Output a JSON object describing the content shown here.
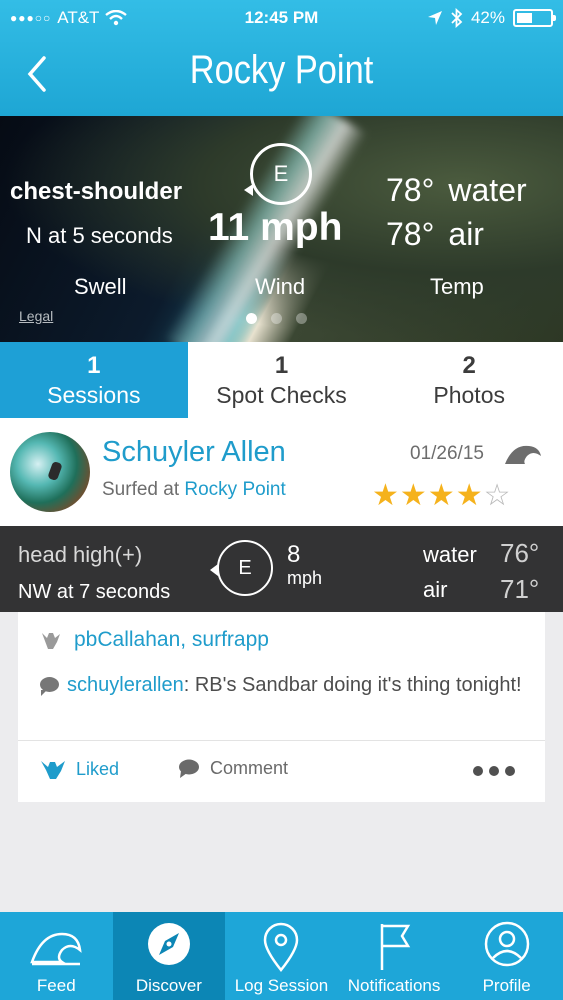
{
  "status_bar": {
    "carrier": "AT&T",
    "time": "12:45 PM",
    "battery": "42%"
  },
  "header": {
    "title": "Rocky Point"
  },
  "hero": {
    "swell_height": "chest-shoulder",
    "swell_detail": "N at 5 seconds",
    "wind_direction": "E",
    "wind_speed": "11 mph",
    "water_temp": "78°",
    "water_label": "water",
    "air_temp": "78°",
    "air_label": "air",
    "labels": {
      "swell": "Swell",
      "wind": "Wind",
      "temp": "Temp"
    },
    "legal": "Legal",
    "pages": 3,
    "active_page": 0
  },
  "tabs": [
    {
      "count": "1",
      "label": "Sessions",
      "active": true
    },
    {
      "count": "1",
      "label": "Spot Checks",
      "active": false
    },
    {
      "count": "2",
      "label": "Photos",
      "active": false
    }
  ],
  "session": {
    "user": "Schuyler Allen",
    "surfed_prefix": "Surfed at ",
    "spot": "Rocky Point",
    "date": "01/26/15",
    "rating": 4,
    "rating_max": 5
  },
  "conditions": {
    "height": "head high(+)",
    "swell": "NW at 7 seconds",
    "wind_direction": "E",
    "wind_speed": "8",
    "wind_unit": "mph",
    "water_label": "water",
    "water_temp": "76°",
    "air_label": "air",
    "air_temp": "71°"
  },
  "social": {
    "likers": "pbCallahan, surfrapp",
    "comment_user": "schuylerallen",
    "comment_text": ": RB's Sandbar doing it's thing tonight!",
    "liked_label": "Liked",
    "comment_label": "Comment"
  },
  "tabbar": [
    {
      "label": "Feed",
      "icon": "wave-icon",
      "active": false
    },
    {
      "label": "Discover",
      "icon": "compass-icon",
      "active": true
    },
    {
      "label": "Log Session",
      "icon": "map-pin-icon",
      "active": false
    },
    {
      "label": "Notifications",
      "icon": "flag-icon",
      "active": false
    },
    {
      "label": "Profile",
      "icon": "profile-icon",
      "active": false
    }
  ],
  "colors": {
    "brand": "#1ea6d8",
    "active_tab": "#0c86b5",
    "link": "#1f9ccb",
    "star": "#f5b21c",
    "conditions_bar": "#333334"
  }
}
